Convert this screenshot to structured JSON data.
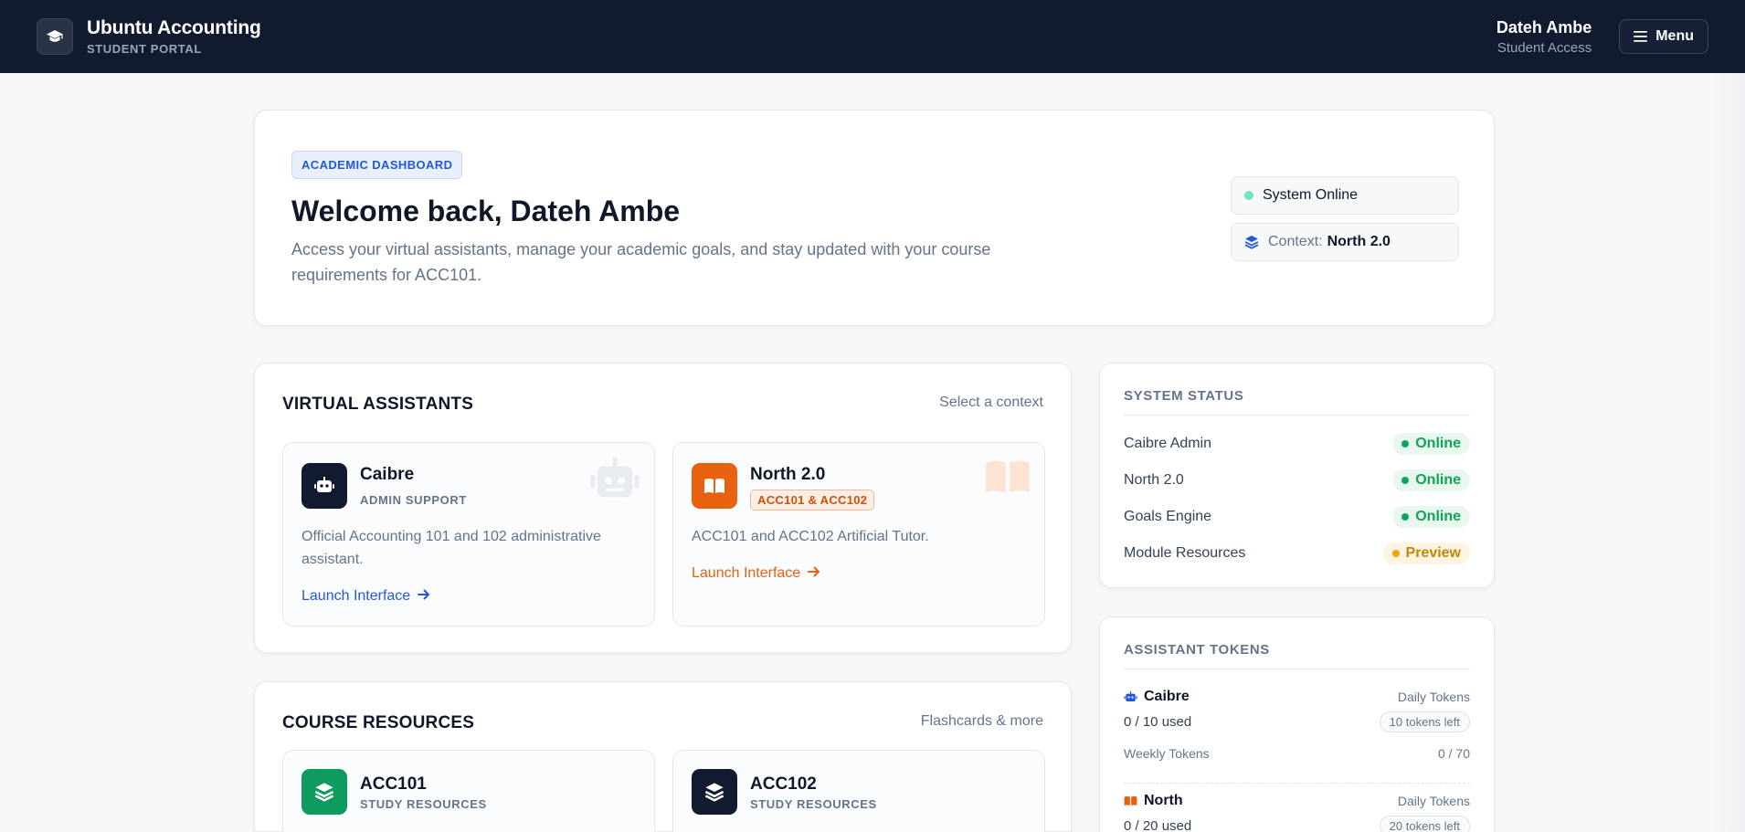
{
  "header": {
    "brand_title": "Ubuntu Accounting",
    "brand_subtitle": "STUDENT PORTAL",
    "user_name": "Dateh Ambe",
    "user_role": "Student Access",
    "menu_label": "Menu"
  },
  "welcome": {
    "badge": "ACADEMIC DASHBOARD",
    "title": "Welcome back, Dateh Ambe",
    "description": "Access your virtual assistants, manage your academic goals, and stay updated with your course requirements for ACC101.",
    "system_status": "System Online",
    "context_label": "Context:",
    "context_value": "North 2.0"
  },
  "assistants": {
    "title": "VIRTUAL ASSISTANTS",
    "hint": "Select a context",
    "items": [
      {
        "name": "Caibre",
        "tag": "ADMIN SUPPORT",
        "description": "Official Accounting 101 and 102 administrative assistant.",
        "link": "Launch Interface",
        "color": "#2358d8"
      },
      {
        "name": "North 2.0",
        "tag": "ACC101 & ACC102",
        "description": "ACC101 and ACC102 Artificial Tutor.",
        "link": "Launch Interface",
        "color": "#e8610f"
      }
    ]
  },
  "resources": {
    "title": "COURSE RESOURCES",
    "hint": "Flashcards & more",
    "items": [
      {
        "name": "ACC101",
        "tag": "STUDY RESOURCES",
        "color": "#0f9a5f"
      },
      {
        "name": "ACC102",
        "tag": "STUDY RESOURCES",
        "color": "#111a2e"
      }
    ]
  },
  "system_status": {
    "title": "SYSTEM STATUS",
    "rows": [
      {
        "label": "Caibre Admin",
        "status": "Online"
      },
      {
        "label": "North 2.0",
        "status": "Online"
      },
      {
        "label": "Goals Engine",
        "status": "Online"
      },
      {
        "label": "Module Resources",
        "status": "Preview"
      }
    ]
  },
  "tokens": {
    "title": "ASSISTANT TOKENS",
    "items": [
      {
        "name": "Caibre",
        "daily_label": "Daily Tokens",
        "used": "0 / 10 used",
        "left": "10 tokens left",
        "weekly_label": "Weekly Tokens",
        "weekly_value": "0 / 70"
      },
      {
        "name": "North",
        "daily_label": "Daily Tokens",
        "used": "0 / 20 used",
        "left": "20 tokens left"
      }
    ]
  }
}
